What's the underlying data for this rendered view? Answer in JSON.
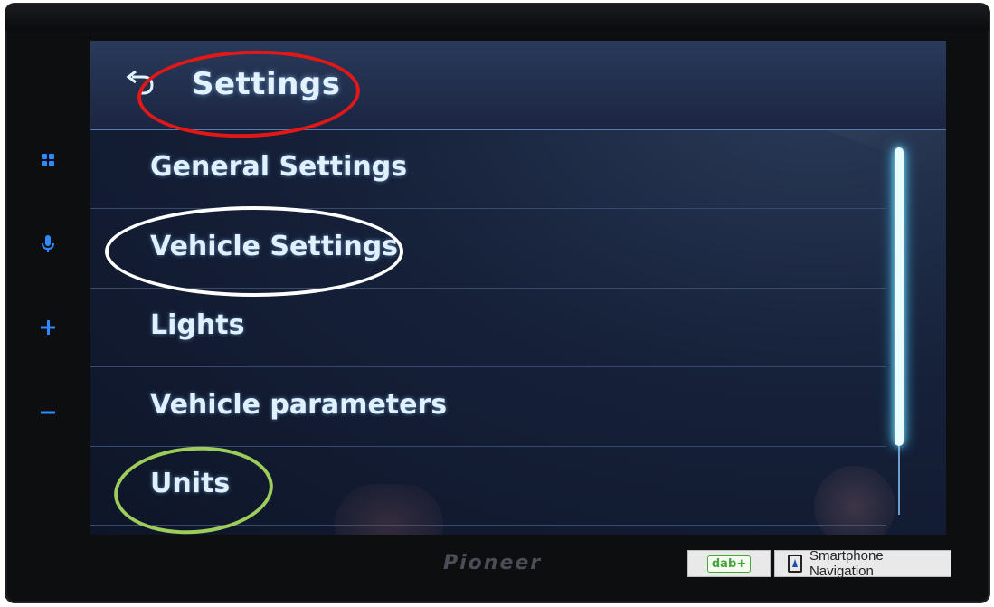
{
  "header": {
    "title": "Settings",
    "back_icon": "back-arrow-icon"
  },
  "menu": {
    "items": [
      {
        "label": "General Settings"
      },
      {
        "label": "Vehicle Settings"
      },
      {
        "label": "Lights"
      },
      {
        "label": "Vehicle parameters"
      },
      {
        "label": "Units"
      }
    ]
  },
  "side_buttons": {
    "icons": [
      "apps-grid-icon",
      "microphone-icon",
      "plus-icon",
      "minus-icon"
    ]
  },
  "annotations": {
    "colors": {
      "settings": "#e11818",
      "vehicle_settings": "#ffffff",
      "units": "#9ccc5a"
    }
  },
  "brand": "Pioneer",
  "badges": {
    "dab": "dab+",
    "nav": "Smartphone Navigation"
  },
  "colors": {
    "accent": "#2d8bff",
    "text": "#dff0ff",
    "scroll": "#e8fbff"
  }
}
